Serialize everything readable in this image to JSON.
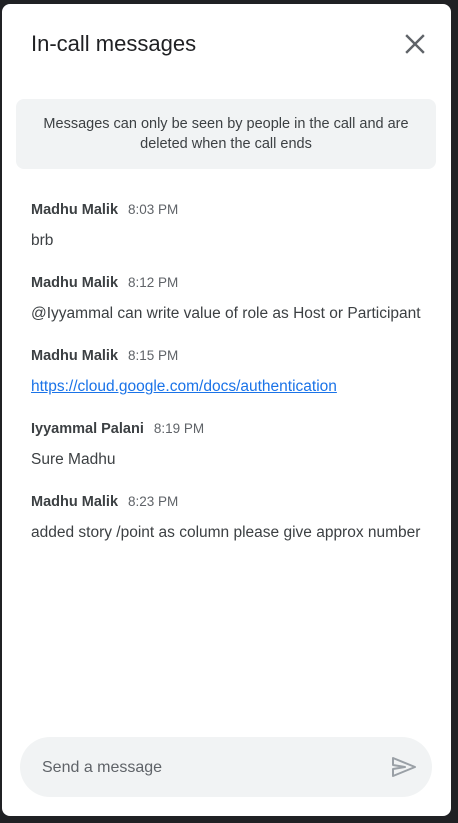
{
  "header": {
    "title": "In-call messages",
    "close_icon": "close-icon"
  },
  "notice": {
    "text": "Messages can only be seen by people in the call and are deleted when the call ends"
  },
  "messages": [
    {
      "sender": "Madhu Malik",
      "time": "8:03 PM",
      "text": "brb",
      "is_link": false
    },
    {
      "sender": "Madhu Malik",
      "time": "8:12 PM",
      "text": "@Iyyammal can write value of role as Host or Participant",
      "is_link": false
    },
    {
      "sender": "Madhu Malik",
      "time": "8:15 PM",
      "text": "https://cloud.google.com/docs/authentication",
      "is_link": true
    },
    {
      "sender": "Iyyammal Palani",
      "time": "8:19 PM",
      "text": "Sure Madhu",
      "is_link": false
    },
    {
      "sender": "Madhu Malik",
      "time": "8:23 PM",
      "text": "added story /point as column please give approx number",
      "is_link": false
    }
  ],
  "composer": {
    "placeholder": "Send a message",
    "value": "",
    "send_icon": "send-icon"
  },
  "colors": {
    "link": "#1a73e8",
    "notice_bg": "#f1f3f4",
    "background": "#202124"
  }
}
